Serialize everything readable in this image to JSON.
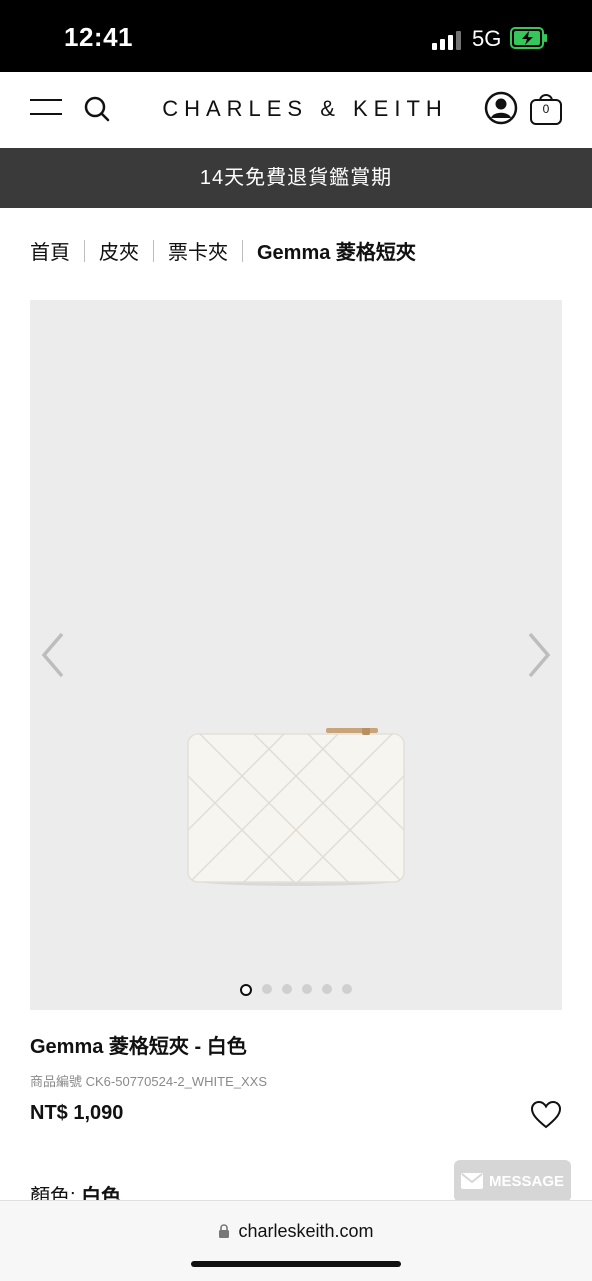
{
  "status_bar": {
    "time": "12:41",
    "network": "5G"
  },
  "header": {
    "brand": "CHARLES & KEITH",
    "bag_count": "0"
  },
  "promo_banner": {
    "text": "14天免費退貨鑑賞期"
  },
  "breadcrumb": {
    "items": [
      "首頁",
      "皮夾",
      "票卡夾"
    ],
    "current": "Gemma 菱格短夾"
  },
  "product": {
    "title": "Gemma 菱格短夾 - 白色",
    "sku": "商品編號 CK6-50770524-2_WHITE_XXS",
    "price": "NT$ 1,090",
    "color_label": "顏色:",
    "color_value": "白色"
  },
  "gallery": {
    "image_count": 6,
    "active_index": 0
  },
  "message_button": {
    "label": "MESSAGE"
  },
  "browser": {
    "url": "charleskeith.com"
  },
  "colors": {
    "banner_bg": "#3a3a3a",
    "gallery_bg": "#ececec",
    "battery_green": "#34c759"
  }
}
